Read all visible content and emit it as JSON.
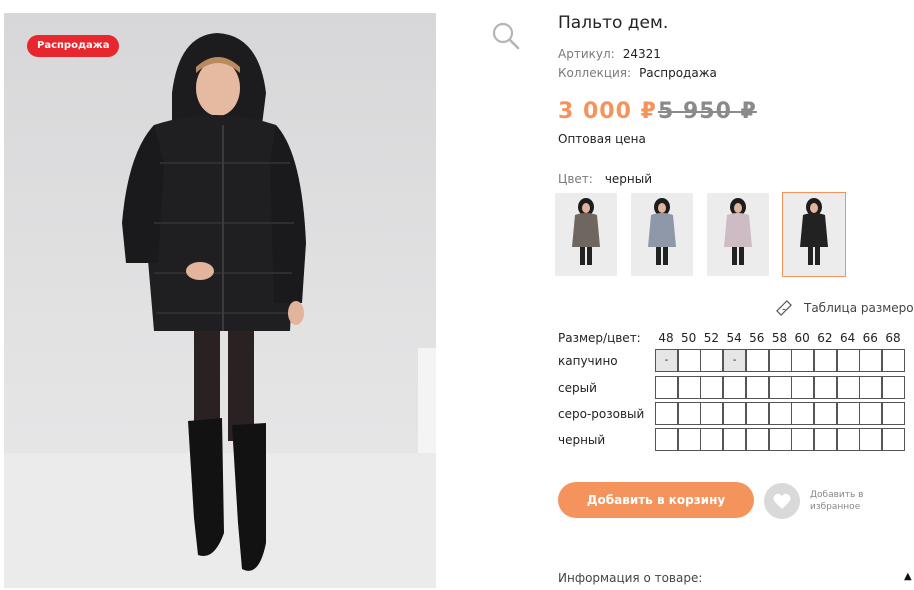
{
  "badge": "Распродажа",
  "product": {
    "title": "Пальто дем.",
    "article_label": "Артикул:",
    "article_value": "24321",
    "collection_label": "Коллекция:",
    "collection_value": "Распродажа",
    "price": "3 000 ₽",
    "old_price": "5 950 ₽",
    "price_note": "Оптовая цена",
    "color_label": "Цвет:",
    "color_value": "черный"
  },
  "thumbnails": [
    {
      "name": "капучино",
      "coat_color": "#6f6660",
      "active": false
    },
    {
      "name": "серый",
      "coat_color": "#8f98a8",
      "active": false
    },
    {
      "name": "серо-розовый",
      "coat_color": "#cdbcc4",
      "active": false
    },
    {
      "name": "черный",
      "coat_color": "#222222",
      "active": true
    }
  ],
  "size_table_link": "Таблица размеров",
  "size_grid": {
    "header_label": "Размер/цвет:",
    "sizes": [
      "48",
      "50",
      "52",
      "54",
      "56",
      "58",
      "60",
      "62",
      "64",
      "66",
      "68"
    ],
    "rows": [
      {
        "label": "капучино",
        "cells": [
          "-",
          "",
          "",
          "-",
          "",
          "",
          "",
          "",
          "",
          "",
          ""
        ],
        "na": [
          0,
          3
        ]
      },
      {
        "label": "серый",
        "cells": [
          "",
          "",
          "",
          "",
          "",
          "",
          "",
          "",
          "",
          "",
          ""
        ],
        "na": []
      },
      {
        "label": "серо-розовый",
        "cells": [
          "",
          "",
          "",
          "",
          "",
          "",
          "",
          "",
          "",
          "",
          ""
        ],
        "na": []
      },
      {
        "label": "черный",
        "cells": [
          "",
          "",
          "",
          "",
          "",
          "",
          "",
          "",
          "",
          "",
          ""
        ],
        "na": []
      }
    ]
  },
  "buttons": {
    "add_to_cart": "Добавить в корзину",
    "favorite_line1": "Добавить в",
    "favorite_line2": "избранное"
  },
  "info_label": "Информация о товаре:",
  "info_arrow": "▲",
  "colors": {
    "accent": "#f5935c",
    "badge": "#e8262d",
    "muted": "#7a7a7a"
  }
}
